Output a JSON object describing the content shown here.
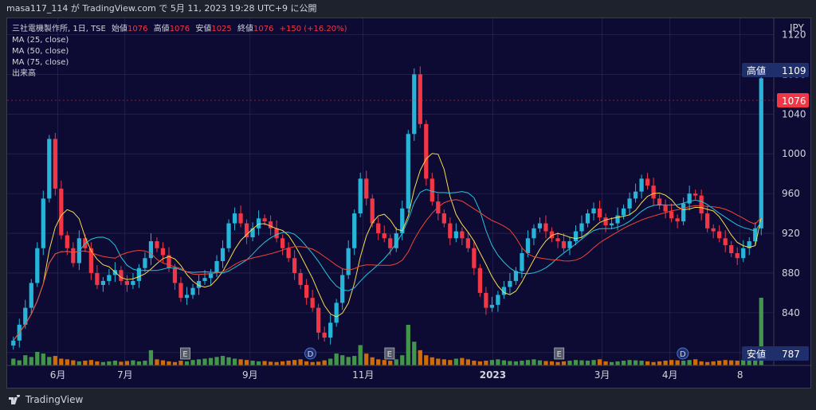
{
  "header": {
    "publish_info": "masa117_114 が TradingView.com で 5月 11, 2023 19:28 UTC+9 に公開"
  },
  "legend": {
    "symbol_line_prefix": "三社電機製作所, 1日, TSE",
    "open_label": "始値",
    "open_value": "1076",
    "high_label": "高値",
    "high_value": "1076",
    "low_label": "安値",
    "low_value": "1025",
    "close_label": "終値",
    "close_value": "1076",
    "change": "+150 (+16.20%)",
    "ma25": "MA (25, close)",
    "ma50": "MA (50, close)",
    "ma75": "MA (75, close)",
    "volume": "出来高"
  },
  "price_axis": {
    "currency": "JPY",
    "ticks": [
      "1120",
      "1080",
      "1040",
      "1000",
      "960",
      "920",
      "880",
      "840",
      "800"
    ]
  },
  "markers": {
    "high_label": "高値",
    "high_value": "1109",
    "last_value": "1076",
    "low_label": "安値",
    "low_value": "787"
  },
  "time_axis": {
    "labels": [
      "6月",
      "7月",
      "9月",
      "11月",
      "2023",
      "3月",
      "4月",
      "8"
    ]
  },
  "events": [
    "E",
    "D",
    "E",
    "E",
    "D"
  ],
  "footer": {
    "brand": "TradingView"
  },
  "colors": {
    "up": "#26b5d8",
    "down": "#f23645",
    "ma25": "#f5dc4c",
    "ma50": "#26c6da",
    "ma75": "#f44336",
    "background": "#0d0b33",
    "vol_up": "#4caf50",
    "vol_down": "#f57c00"
  },
  "chart_data": {
    "type": "candlestick",
    "ylim": [
      787,
      1130
    ],
    "price_path": [
      812,
      828,
      845,
      870,
      905,
      955,
      1015,
      965,
      918,
      905,
      890,
      915,
      905,
      880,
      868,
      872,
      878,
      883,
      872,
      868,
      872,
      885,
      895,
      912,
      905,
      898,
      885,
      870,
      855,
      858,
      865,
      872,
      875,
      880,
      892,
      905,
      930,
      940,
      930,
      916,
      925,
      935,
      932,
      925,
      915,
      905,
      895,
      880,
      868,
      855,
      845,
      820,
      815,
      830,
      850,
      878,
      905,
      940,
      975,
      955,
      930,
      920,
      915,
      905,
      920,
      945,
      1020,
      1080,
      1030,
      975,
      952,
      940,
      930,
      915,
      922,
      915,
      905,
      885,
      860,
      845,
      848,
      858,
      866,
      872,
      882,
      900,
      915,
      925,
      930,
      922,
      915,
      912,
      905,
      912,
      922,
      930,
      940,
      945,
      936,
      928,
      930,
      938,
      945,
      955,
      962,
      975,
      968,
      955,
      948,
      942,
      935,
      932,
      950,
      960,
      958,
      940,
      925,
      922,
      915,
      908,
      900,
      895,
      905,
      912,
      925,
      1076
    ],
    "volume_path": [
      20,
      15,
      30,
      25,
      40,
      35,
      25,
      28,
      20,
      18,
      15,
      12,
      14,
      16,
      12,
      10,
      12,
      14,
      11,
      13,
      15,
      12,
      14,
      45,
      18,
      15,
      12,
      10,
      14,
      12,
      16,
      18,
      20,
      22,
      25,
      28,
      24,
      20,
      18,
      16,
      14,
      12,
      13,
      11,
      10,
      12,
      14,
      16,
      18,
      12,
      10,
      11,
      15,
      20,
      35,
      30,
      25,
      28,
      60,
      35,
      24,
      18,
      16,
      14,
      18,
      30,
      120,
      70,
      45,
      30,
      24,
      20,
      18,
      16,
      20,
      22,
      18,
      14,
      12,
      14,
      16,
      18,
      15,
      13,
      12,
      14,
      16,
      18,
      15,
      13,
      12,
      10,
      12,
      14,
      16,
      15,
      14,
      16,
      18,
      12,
      10,
      12,
      14,
      16,
      15,
      14,
      12,
      10,
      12,
      14,
      16,
      15,
      14,
      16,
      18,
      12,
      10,
      12,
      14,
      16,
      15,
      14,
      16,
      18,
      25,
      200
    ]
  }
}
